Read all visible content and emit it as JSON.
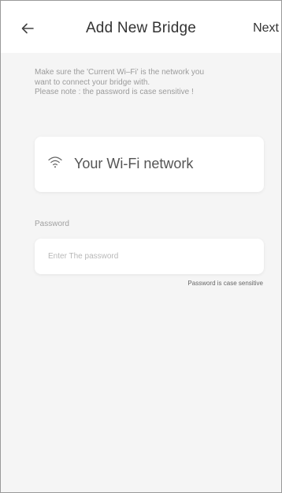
{
  "header": {
    "back_icon": "arrow-left-icon",
    "title": "Add New Bridge",
    "next_label": "Next"
  },
  "instructions": {
    "line1": "Make sure the 'Current Wi–Fi' is the network you",
    "line2": "want to connect your bridge with.",
    "line3": "Please note : the password is case sensitive !"
  },
  "wifi": {
    "icon": "wifi-icon",
    "label": "Your Wi-Fi network"
  },
  "password": {
    "label": "Password",
    "value": "",
    "placeholder": "Enter The password",
    "hint": "Password is case sensitive"
  },
  "colors": {
    "background": "#f5f5f5",
    "card": "#ffffff",
    "title_text": "#333333",
    "secondary_text": "#9b9b9b"
  }
}
